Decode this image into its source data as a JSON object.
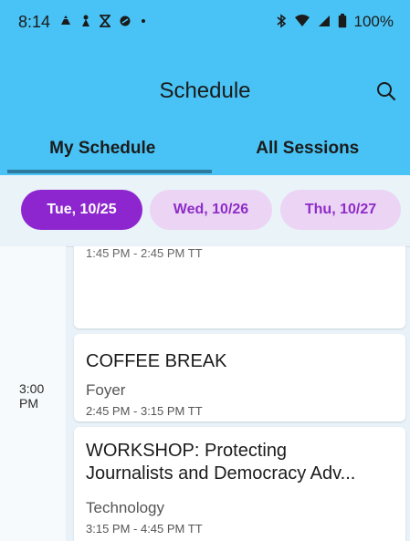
{
  "status_bar": {
    "time": "8:14",
    "battery": "100%",
    "left_icons": [
      "notification-icon",
      "notification-icon",
      "hourglass-icon",
      "sync-icon",
      "dot-icon"
    ],
    "right_icons": [
      "bluetooth-icon",
      "wifi-icon",
      "signal-icon",
      "battery-icon"
    ]
  },
  "app_bar": {
    "title": "Schedule",
    "search_icon": "search-icon"
  },
  "tabs": [
    {
      "label": "My Schedule",
      "selected": true
    },
    {
      "label": "All Sessions",
      "selected": false
    }
  ],
  "day_chips": [
    {
      "label": "Tue, 10/25",
      "selected": true
    },
    {
      "label": "Wed, 10/26",
      "selected": false
    },
    {
      "label": "Thu, 10/27",
      "selected": false
    }
  ],
  "time_label": "3:00\nPM",
  "sessions": [
    {
      "title": "",
      "room": "",
      "time": "1:45 PM - 2:45 PM TT"
    },
    {
      "title": "COFFEE BREAK",
      "room": "Foyer",
      "time": "2:45 PM - 3:15 PM TT"
    },
    {
      "title_line1": "WORKSHOP: Protecting",
      "title_line2": "Journalists and Democracy Adv...",
      "room": "Technology",
      "time": "3:15 PM - 4:45 PM TT"
    }
  ],
  "colors": {
    "header": "#49c3f5",
    "tab_indicator": "#2d7aa0",
    "chip_selected": "#8e26cf",
    "chip_unselected": "#ecd4f4",
    "chip_unselected_text": "#8d2cc7"
  }
}
